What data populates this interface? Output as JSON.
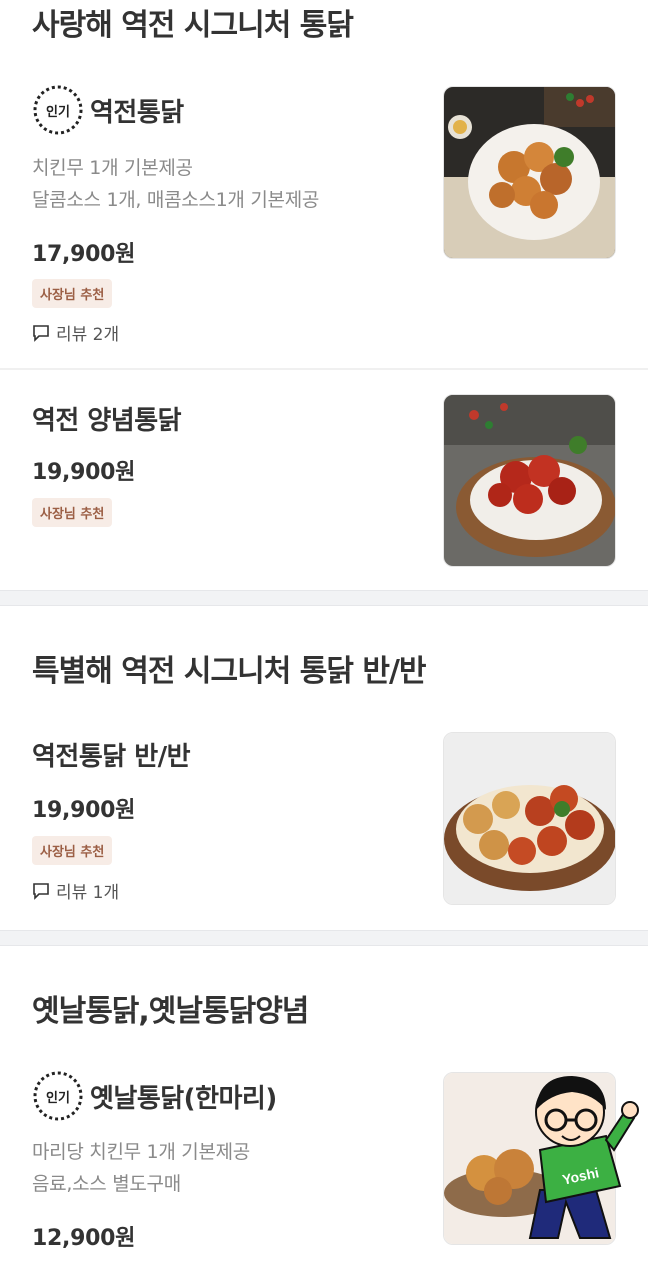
{
  "sections": [
    {
      "title": "사랑해 역전 시그니처 통닭",
      "items": [
        {
          "popular_label": "인기",
          "name": "역전통닭",
          "desc": [
            "치킨무 1개 기본제공",
            "달콤소스 1개, 매콤소스1개 기본제공"
          ],
          "price": "17,900원",
          "badge": "사장님 추천",
          "review": "리뷰 2개"
        },
        {
          "name": "역전 양념통닭",
          "price": "19,900원",
          "badge": "사장님 추천"
        }
      ]
    },
    {
      "title": "특별해 역전 시그니처 통닭 반/반",
      "items": [
        {
          "name": "역전통닭 반/반",
          "price": "19,900원",
          "badge": "사장님 추천",
          "review": "리뷰 1개"
        }
      ]
    },
    {
      "title": "옛날통닭,옛날통닭양념",
      "items": [
        {
          "popular_label": "인기",
          "name": "옛날통닭(한마리)",
          "desc": [
            "마리당 치킨무 1개 기본제공",
            "음료,소스 별도구매"
          ],
          "price": "12,900원"
        }
      ]
    }
  ],
  "sticker_text": "Yoshi",
  "colors": {
    "badge_bg": "#f7ece6",
    "badge_text": "#9b5e44",
    "divider": "#f2f3f5"
  }
}
